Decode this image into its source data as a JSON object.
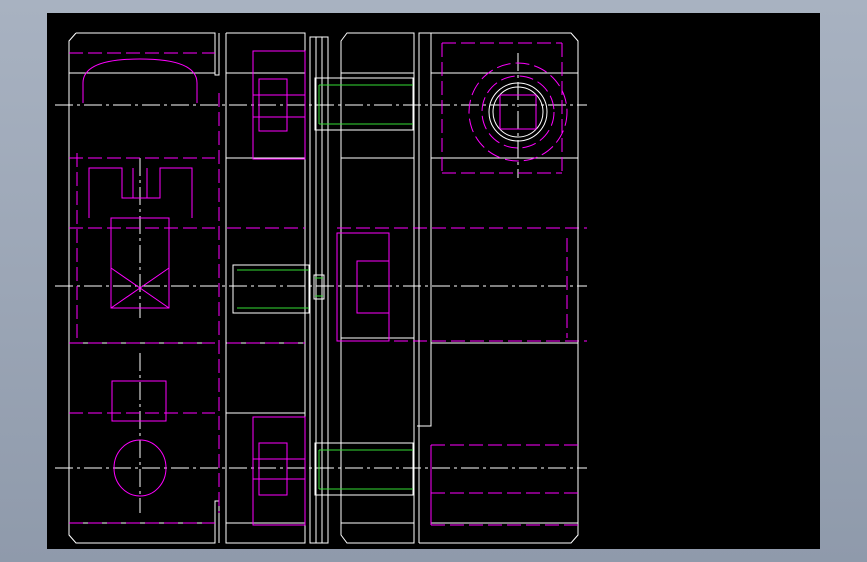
{
  "window": {
    "background": "#a8b2c1"
  },
  "viewport": {
    "background": "#000000"
  },
  "palette": {
    "outline": "#ffffff",
    "hidden": "#ff00ff",
    "thread": "#33dd33",
    "centerline": "#ffffff"
  }
}
